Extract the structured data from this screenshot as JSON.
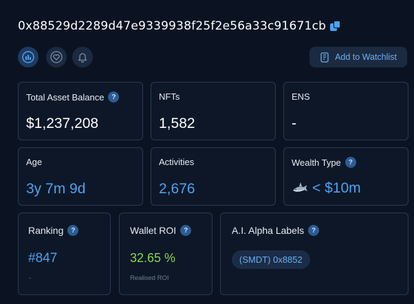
{
  "wallet": {
    "address": "0x88529d2289d47e9339938f25f2e56a33c91671cb"
  },
  "actions": {
    "watchlist_label": "Add to Watchlist"
  },
  "stats": {
    "total_asset_balance": {
      "label": "Total Asset Balance",
      "value": "$1,237,208"
    },
    "nfts": {
      "label": "NFTs",
      "value": "1,582"
    },
    "ens": {
      "label": "ENS",
      "value": "-"
    },
    "age": {
      "label": "Age",
      "value": "3y 7m 9d"
    },
    "activities": {
      "label": "Activities",
      "value": "2,676"
    },
    "wealth_type": {
      "label": "Wealth Type",
      "value": "< $10m",
      "icon": "shark-icon"
    },
    "ranking": {
      "label": "Ranking",
      "value": "#847",
      "sub": "-"
    },
    "wallet_roi": {
      "label": "Wallet ROI",
      "value": "32.65 %",
      "sub": "Realised ROI"
    },
    "ai_alpha_labels": {
      "label": "A.I. Alpha Labels",
      "tags": [
        "(SMDT) 0x8852"
      ]
    }
  },
  "colors": {
    "background": "#0b1322",
    "accent_blue": "#4aa3f0",
    "roi_green": "#86d44a",
    "card_border": "#2a3a55"
  },
  "help_glyph": "?"
}
